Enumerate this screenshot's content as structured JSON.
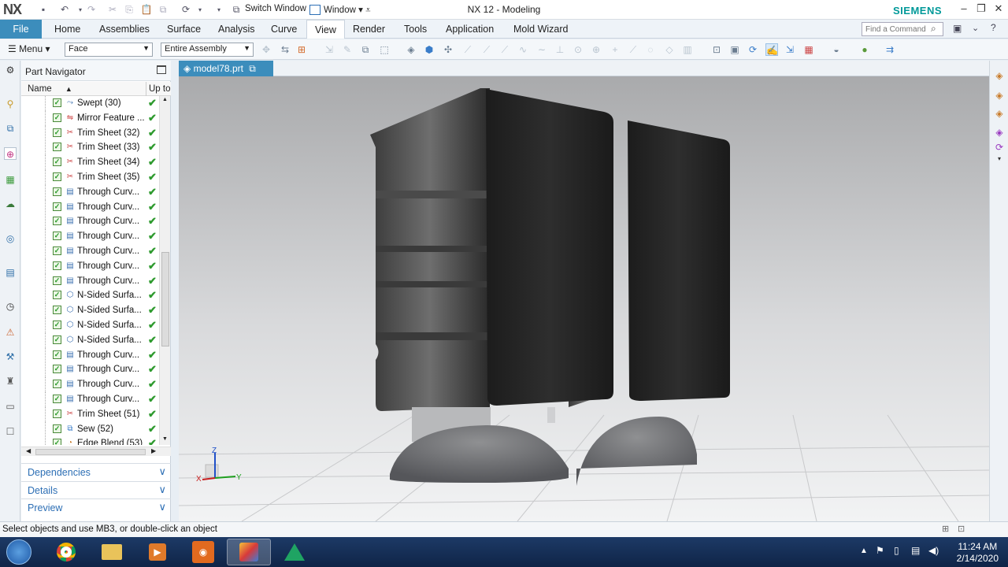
{
  "titlebar": {
    "logo": "NX",
    "title": "NX 12 - Modeling",
    "brand": "SIEMENS",
    "switch_window": "Switch Window",
    "window_menu": "Window"
  },
  "tabs": {
    "file": "File",
    "items": [
      "Home",
      "Assemblies",
      "Surface",
      "Analysis",
      "Curve",
      "View",
      "Render",
      "Tools",
      "Application",
      "Mold Wizard"
    ],
    "active": "View"
  },
  "find_command": {
    "placeholder": "Find a Command"
  },
  "toolbar": {
    "menu_label": "Menu",
    "filter_value": "Face",
    "scope_value": "Entire Assembly"
  },
  "navigator": {
    "title": "Part Navigator",
    "col_name": "Name",
    "col_uptodate": "Up to",
    "rows": [
      {
        "label": "Swept (30)",
        "icon": "swept-icon"
      },
      {
        "label": "Mirror Feature ...",
        "icon": "mirror-icon"
      },
      {
        "label": "Trim Sheet (32)",
        "icon": "trim-sheet-icon"
      },
      {
        "label": "Trim Sheet (33)",
        "icon": "trim-sheet-icon"
      },
      {
        "label": "Trim Sheet (34)",
        "icon": "trim-sheet-icon"
      },
      {
        "label": "Trim Sheet (35)",
        "icon": "trim-sheet-icon"
      },
      {
        "label": "Through Curv...",
        "icon": "through-curves-icon"
      },
      {
        "label": "Through Curv...",
        "icon": "through-curves-icon"
      },
      {
        "label": "Through Curv...",
        "icon": "through-curves-icon"
      },
      {
        "label": "Through Curv...",
        "icon": "through-curves-icon"
      },
      {
        "label": "Through Curv...",
        "icon": "through-curves-icon"
      },
      {
        "label": "Through Curv...",
        "icon": "through-curves-icon"
      },
      {
        "label": "Through Curv...",
        "icon": "through-curves-icon"
      },
      {
        "label": "N-Sided Surfa...",
        "icon": "n-sided-surface-icon"
      },
      {
        "label": "N-Sided Surfa...",
        "icon": "n-sided-surface-icon"
      },
      {
        "label": "N-Sided Surfa...",
        "icon": "n-sided-surface-icon"
      },
      {
        "label": "N-Sided Surfa...",
        "icon": "n-sided-surface-icon"
      },
      {
        "label": "Through Curv...",
        "icon": "through-curves-icon"
      },
      {
        "label": "Through Curv...",
        "icon": "through-curves-icon"
      },
      {
        "label": "Through Curv...",
        "icon": "through-curves-icon"
      },
      {
        "label": "Through Curv...",
        "icon": "through-curves-icon"
      },
      {
        "label": "Trim Sheet (51)",
        "icon": "trim-sheet-icon"
      },
      {
        "label": "Sew (52)",
        "icon": "sew-icon"
      },
      {
        "label": "Edge Blend (53)",
        "icon": "edge-blend-icon"
      }
    ],
    "accordions": [
      "Dependencies",
      "Details",
      "Preview"
    ]
  },
  "document": {
    "tab_label": "model78.prt"
  },
  "axes": {
    "z": "Z",
    "x": "X",
    "y": "Y"
  },
  "status": {
    "message": "Select objects and use MB3, or double-click an object"
  },
  "clock": {
    "time": "11:24 AM",
    "date": "2/14/2020"
  }
}
